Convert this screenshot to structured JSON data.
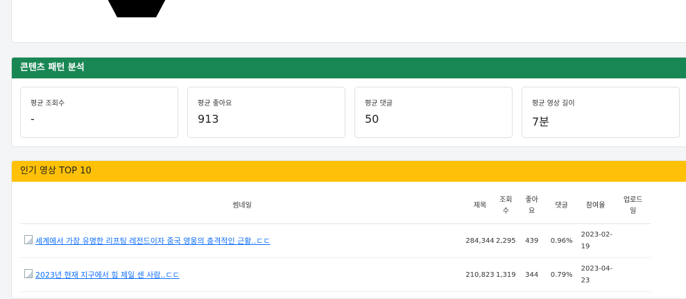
{
  "pattern": {
    "title": "콘텐츠 패턴 분석",
    "stats": [
      {
        "label": "평균 조회수",
        "value": "-"
      },
      {
        "label": "평균 좋아요",
        "value": "913"
      },
      {
        "label": "평균 댓글",
        "value": "50"
      },
      {
        "label": "평균 영상 길이",
        "value": "7분"
      }
    ]
  },
  "top10": {
    "title": "인기 영상 TOP 10",
    "columns": [
      "썸네일",
      "제목",
      "조회수",
      "좋아요",
      "댓글",
      "참여율",
      "업로드일"
    ],
    "rows": [
      {
        "title": "세계에서 가장 유명한 리프팅 레전드이자 중국 영웅의 충격적인 근황..ㄷㄷ",
        "views": "284,344",
        "likes": "2,295",
        "comments": "439",
        "engagement": "0.96%",
        "date": "2023-02-19"
      },
      {
        "title": "2023년 현재 지구에서 힘 제일 센 사람..ㄷㄷ",
        "views": "210,823",
        "likes": "1,319",
        "comments": "344",
        "engagement": "0.79%",
        "date": "2023-04-23"
      }
    ]
  }
}
